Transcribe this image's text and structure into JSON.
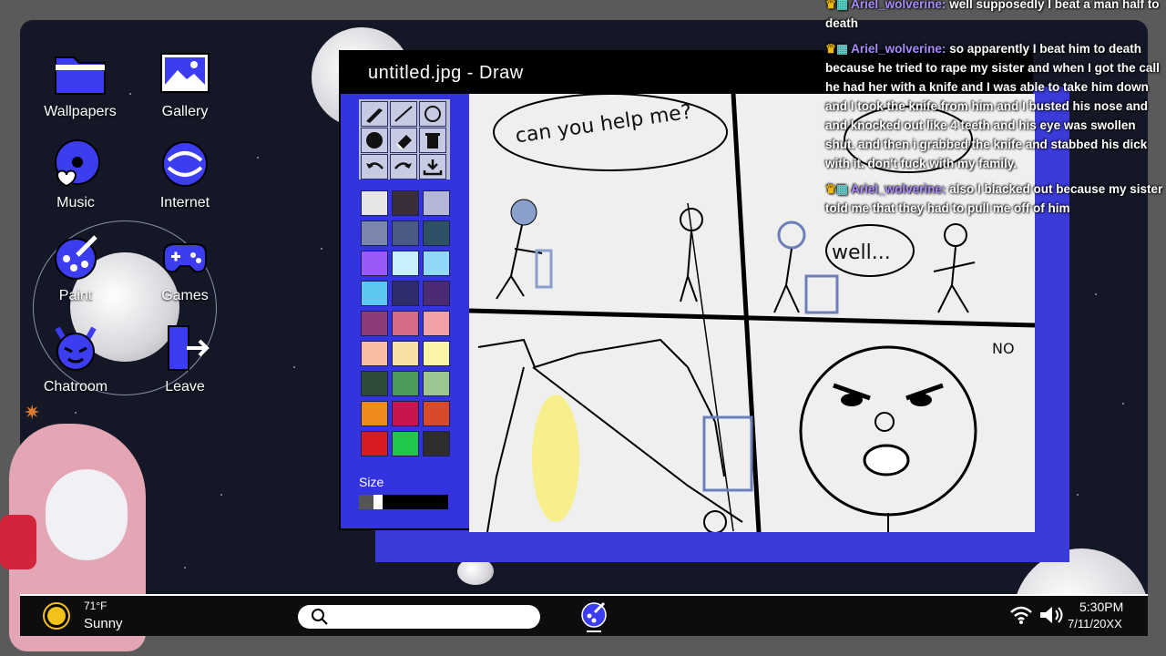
{
  "desktop_icons": [
    {
      "label": "Wallpapers",
      "icon": "folder-icon"
    },
    {
      "label": "Gallery",
      "icon": "image-icon"
    },
    {
      "label": "Music",
      "icon": "music-icon"
    },
    {
      "label": "Internet",
      "icon": "globe-icon"
    },
    {
      "label": "Paint",
      "icon": "palette-icon"
    },
    {
      "label": "Games",
      "icon": "gamepad-icon"
    },
    {
      "label": "Chatroom",
      "icon": "devil-icon"
    },
    {
      "label": "Leave",
      "icon": "exit-door-icon"
    }
  ],
  "window": {
    "title": "untitled.jpg - Draw",
    "tools": [
      "brush-icon",
      "line-icon",
      "circle-icon",
      "fill-circle-icon",
      "eraser-icon",
      "trash-icon",
      "undo-icon",
      "redo-icon",
      "save-icon"
    ],
    "palette": [
      "#e6e6e9",
      "#3a2e3c",
      "#b5b7d8",
      "#7a86ad",
      "#4b5a85",
      "#2d5064",
      "#9b59f5",
      "#c8f0fb",
      "#8fd8f6",
      "#5ac8f1",
      "#2e2c6a",
      "#4d2a74",
      "#8e3b7a",
      "#d46a85",
      "#f3a1a8",
      "#f8bca0",
      "#f8dfa6",
      "#f8f6a4",
      "#2f4a38",
      "#4e9a5a",
      "#9cc58f",
      "#f08a1a",
      "#c8154d",
      "#d84a2a",
      "#d71a23",
      "#1ec84a",
      "#2e2e2e"
    ],
    "size_label": "Size",
    "canvas_texts": [
      "can you help me?",
      "well...",
      "NO"
    ]
  },
  "chat": [
    {
      "user": "Ariel_wolverine:",
      "text": "well supposedly I beat a man half to death"
    },
    {
      "user": "Ariel_wolverine:",
      "text": "so apparently I beat him to death because he tried to rape my sister and when I got the call he had her with a knife and I was able to take him down and I took the knife from him and I busted his nose and and knocked out like 4 teeth and his eye was swollen shut. and then i grabbed the knife and stabbed his dick with it. don't fuck with my family."
    },
    {
      "user": "Ariel_wolverine:",
      "text": "also I blacked out because my sister told me that they had to pull me off of him"
    }
  ],
  "taskbar": {
    "temp": "71°F",
    "weather": "Sunny",
    "time": "5:30PM",
    "date": "7/11/20XX"
  }
}
